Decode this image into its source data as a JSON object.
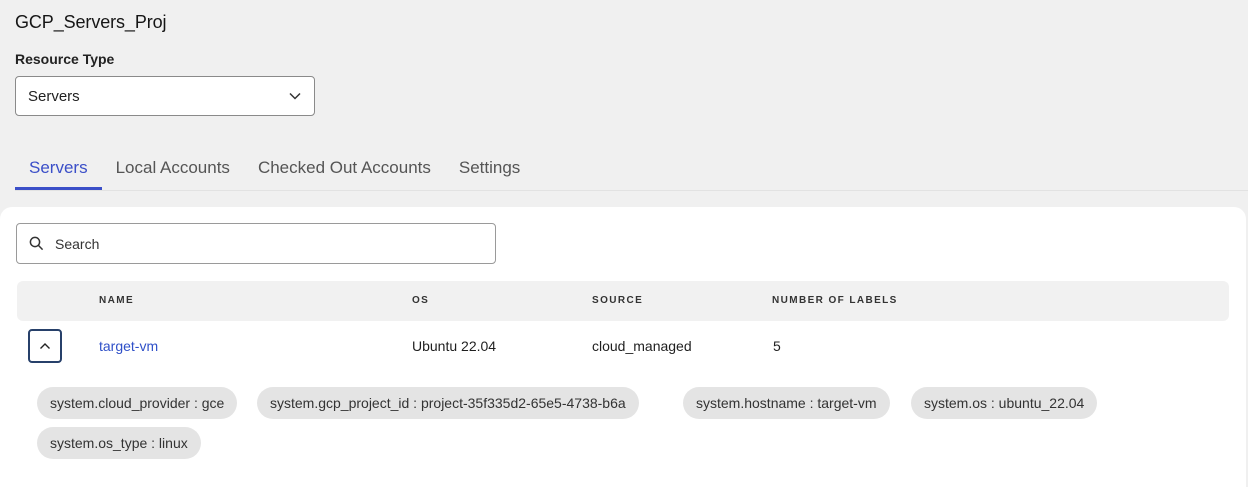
{
  "project": {
    "title": "GCP_Servers_Proj"
  },
  "resource_type": {
    "label": "Resource Type",
    "value": "Servers"
  },
  "tabs": [
    {
      "label": "Servers",
      "active": true
    },
    {
      "label": "Local Accounts",
      "active": false
    },
    {
      "label": "Checked Out Accounts",
      "active": false
    },
    {
      "label": "Settings",
      "active": false
    }
  ],
  "search": {
    "placeholder": "Search"
  },
  "table": {
    "columns": [
      "NAME",
      "OS",
      "SOURCE",
      "NUMBER OF LABELS"
    ],
    "rows": [
      {
        "name": "target-vm",
        "os": "Ubuntu 22.04",
        "source": "cloud_managed",
        "labels_count": "5",
        "expanded": true
      }
    ]
  },
  "labels": [
    "system.cloud_provider : gce",
    "system.gcp_project_id : project-35f335d2-65e5-4738-b6a",
    "system.hostname : target-vm",
    "system.os : ubuntu_22.04",
    "system.os_type : linux"
  ],
  "colors": {
    "accent": "#3b4fc8",
    "link": "#2f50c8",
    "expand_border": "#27406a"
  },
  "icons": {
    "select_chevron": "chevron-down-icon",
    "search": "search-icon",
    "row_toggle": "chevron-up-icon"
  }
}
